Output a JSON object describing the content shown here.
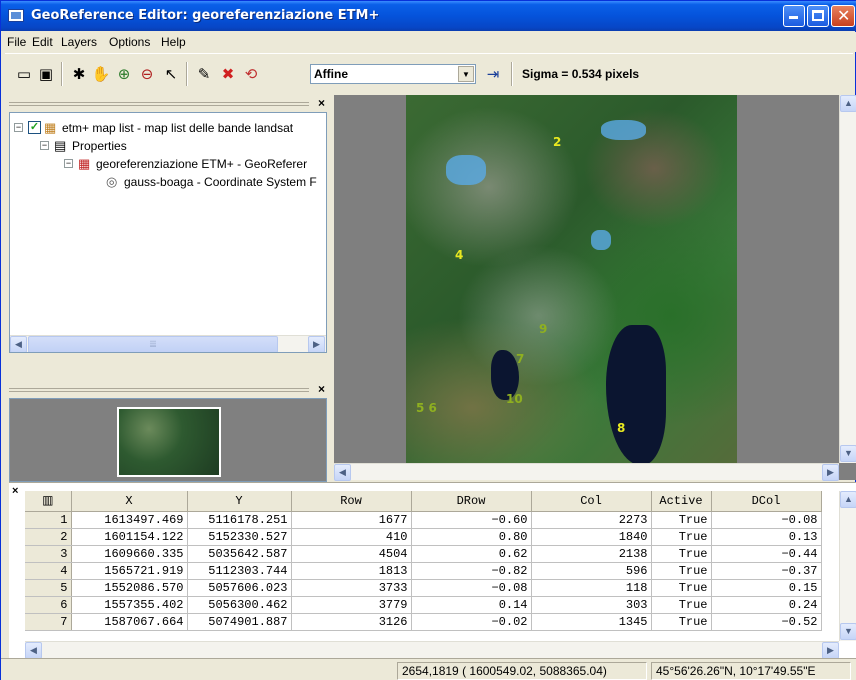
{
  "window": {
    "title": "GeoReference Editor: georeferenziazione ETM+"
  },
  "menu": [
    "File",
    "Edit",
    "Layers",
    "Options",
    "Help"
  ],
  "toolbar": {
    "transformation": "Affine",
    "sigma_text": "Sigma = 0.534 pixels",
    "icons": [
      "new-icon",
      "screen-icon",
      "add-point-icon",
      "pan-icon",
      "zoom-in-icon",
      "zoom-out-icon",
      "select-icon",
      "pencil-icon",
      "delete-icon",
      "refresh-icon",
      "exit-icon"
    ]
  },
  "tree": {
    "root": "etm+ map list - map list delle bande landsat",
    "properties": "Properties",
    "georef": "georeferenziazione ETM+ - GeoReferer",
    "coordsys": "gauss-boaga - Coordinate System F"
  },
  "map": {
    "points": [
      "2",
      "4",
      "9",
      "7",
      "10",
      "5 6",
      "8"
    ]
  },
  "table": {
    "columns": [
      "X",
      "Y",
      "Row",
      "DRow",
      "Col",
      "Active",
      "DCol"
    ],
    "rows": [
      {
        "n": "1",
        "x": "1613497.469",
        "y": "5116178.251",
        "row": "1677",
        "drow": "−0.60",
        "col": "2273",
        "active": "True",
        "dcol": "−0.08"
      },
      {
        "n": "2",
        "x": "1601154.122",
        "y": "5152330.527",
        "row": "410",
        "drow": "0.80",
        "col": "1840",
        "active": "True",
        "dcol": "0.13"
      },
      {
        "n": "3",
        "x": "1609660.335",
        "y": "5035642.587",
        "row": "4504",
        "drow": "0.62",
        "col": "2138",
        "active": "True",
        "dcol": "−0.44"
      },
      {
        "n": "4",
        "x": "1565721.919",
        "y": "5112303.744",
        "row": "1813",
        "drow": "−0.82",
        "col": "596",
        "active": "True",
        "dcol": "−0.37"
      },
      {
        "n": "5",
        "x": "1552086.570",
        "y": "5057606.023",
        "row": "3733",
        "drow": "−0.08",
        "col": "118",
        "active": "True",
        "dcol": "0.15"
      },
      {
        "n": "6",
        "x": "1557355.402",
        "y": "5056300.462",
        "row": "3779",
        "drow": "0.14",
        "col": "303",
        "active": "True",
        "dcol": "0.24"
      },
      {
        "n": "7",
        "x": "1587067.664",
        "y": "5074901.887",
        "row": "3126",
        "drow": "−0.02",
        "col": "1345",
        "active": "True",
        "dcol": "−0.52"
      }
    ]
  },
  "status": {
    "pixel": "2654,1819",
    "coords": "( 1600549.02, 5088365.04)",
    "latlon": "45°56'26.26\"N, 10°17'49.55\"E"
  }
}
